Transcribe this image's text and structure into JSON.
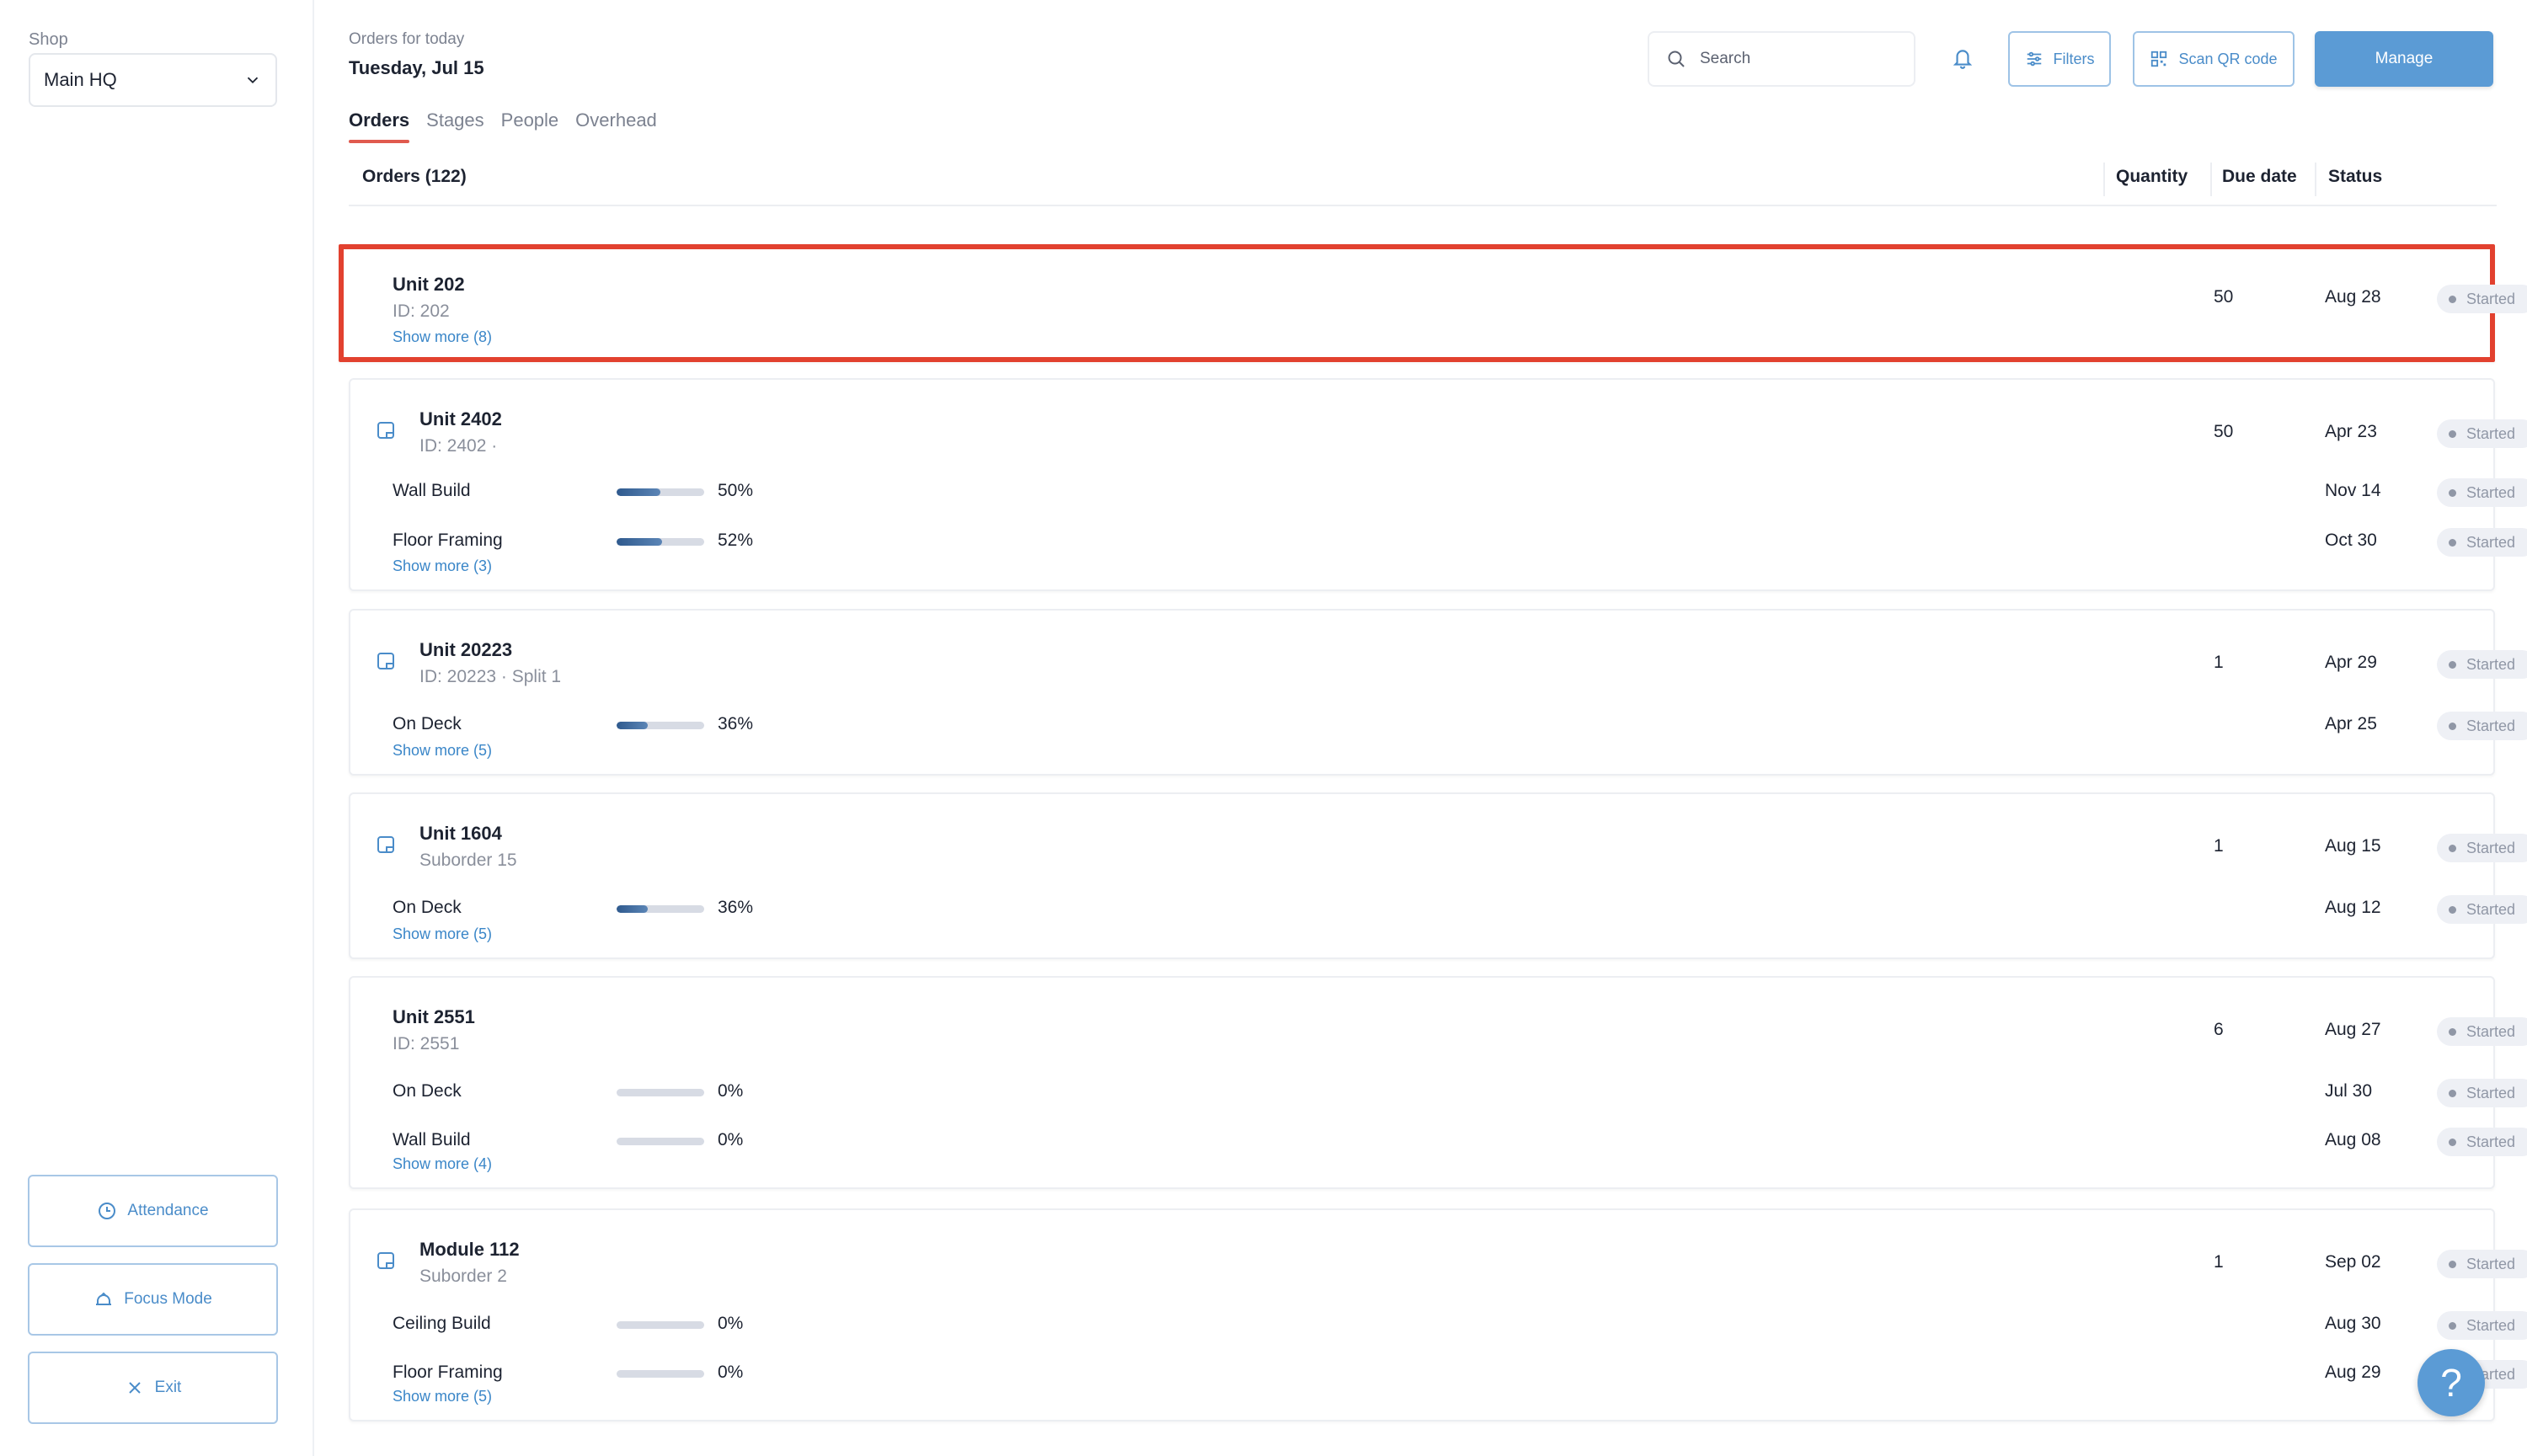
{
  "sidebar": {
    "shop_label": "Shop",
    "shop_value": "Main HQ",
    "attendance_label": "Attendance",
    "focus_label": "Focus Mode",
    "exit_label": "Exit"
  },
  "header": {
    "subtitle": "Orders for today",
    "date": "Tuesday, Jul 15",
    "search_placeholder": "Search",
    "filters_label": "Filters",
    "scan_label": "Scan QR code",
    "manage_label": "Manage"
  },
  "tabs": [
    {
      "label": "Orders",
      "active": true
    },
    {
      "label": "Stages",
      "active": false
    },
    {
      "label": "People",
      "active": false
    },
    {
      "label": "Overhead",
      "active": false
    }
  ],
  "columns": {
    "orders": "Orders (122)",
    "quantity": "Quantity",
    "due_date": "Due date",
    "status": "Status"
  },
  "orders": [
    {
      "name": "Unit 202",
      "sub": "ID: 202",
      "has_icon": false,
      "quantity": "50",
      "due": "Aug 28",
      "status": "Started",
      "stages": [],
      "show_more": "Show more (8)"
    },
    {
      "name": "Unit 2402",
      "sub": "ID: 2402  ·",
      "has_icon": true,
      "quantity": "50",
      "due": "Apr 23",
      "status": "Started",
      "stages": [
        {
          "name": "Wall Build",
          "progress": 50,
          "pct": "50%",
          "due": "Nov 14",
          "status": "Started"
        },
        {
          "name": "Floor Framing",
          "progress": 52,
          "pct": "52%",
          "due": "Oct 30",
          "status": "Started"
        }
      ],
      "show_more": "Show more (3)"
    },
    {
      "name": "Unit 20223",
      "sub": "ID: 20223  ·  Split 1",
      "has_icon": true,
      "quantity": "1",
      "due": "Apr 29",
      "status": "Started",
      "stages": [
        {
          "name": "On Deck",
          "progress": 36,
          "pct": "36%",
          "due": "Apr 25",
          "status": "Started"
        }
      ],
      "show_more": "Show more (5)"
    },
    {
      "name": "Unit 1604",
      "sub": "Suborder 15",
      "has_icon": true,
      "quantity": "1",
      "due": "Aug 15",
      "status": "Started",
      "stages": [
        {
          "name": "On Deck",
          "progress": 36,
          "pct": "36%",
          "due": "Aug 12",
          "status": "Started"
        }
      ],
      "show_more": "Show more (5)"
    },
    {
      "name": "Unit 2551",
      "sub": "ID: 2551",
      "has_icon": false,
      "quantity": "6",
      "due": "Aug 27",
      "status": "Started",
      "stages": [
        {
          "name": "On Deck",
          "progress": 0,
          "pct": "0%",
          "due": "Jul 30",
          "status": "Started"
        },
        {
          "name": "Wall Build",
          "progress": 0,
          "pct": "0%",
          "due": "Aug 08",
          "status": "Started"
        }
      ],
      "show_more": "Show more (4)"
    },
    {
      "name": "Module 112",
      "sub": "Suborder 2",
      "has_icon": true,
      "quantity": "1",
      "due": "Sep 02",
      "status": "Started",
      "stages": [
        {
          "name": "Ceiling Build",
          "progress": 0,
          "pct": "0%",
          "due": "Aug 30",
          "status": "Started"
        },
        {
          "name": "Floor Framing",
          "progress": 0,
          "pct": "0%",
          "due": "Aug 29",
          "status": "Started"
        }
      ],
      "show_more": "Show more (5)"
    }
  ],
  "help_label": "?",
  "colors": {
    "accent": "#5b9bd5",
    "highlight": "#e2412f",
    "tab_underline": "#e05a4e"
  }
}
